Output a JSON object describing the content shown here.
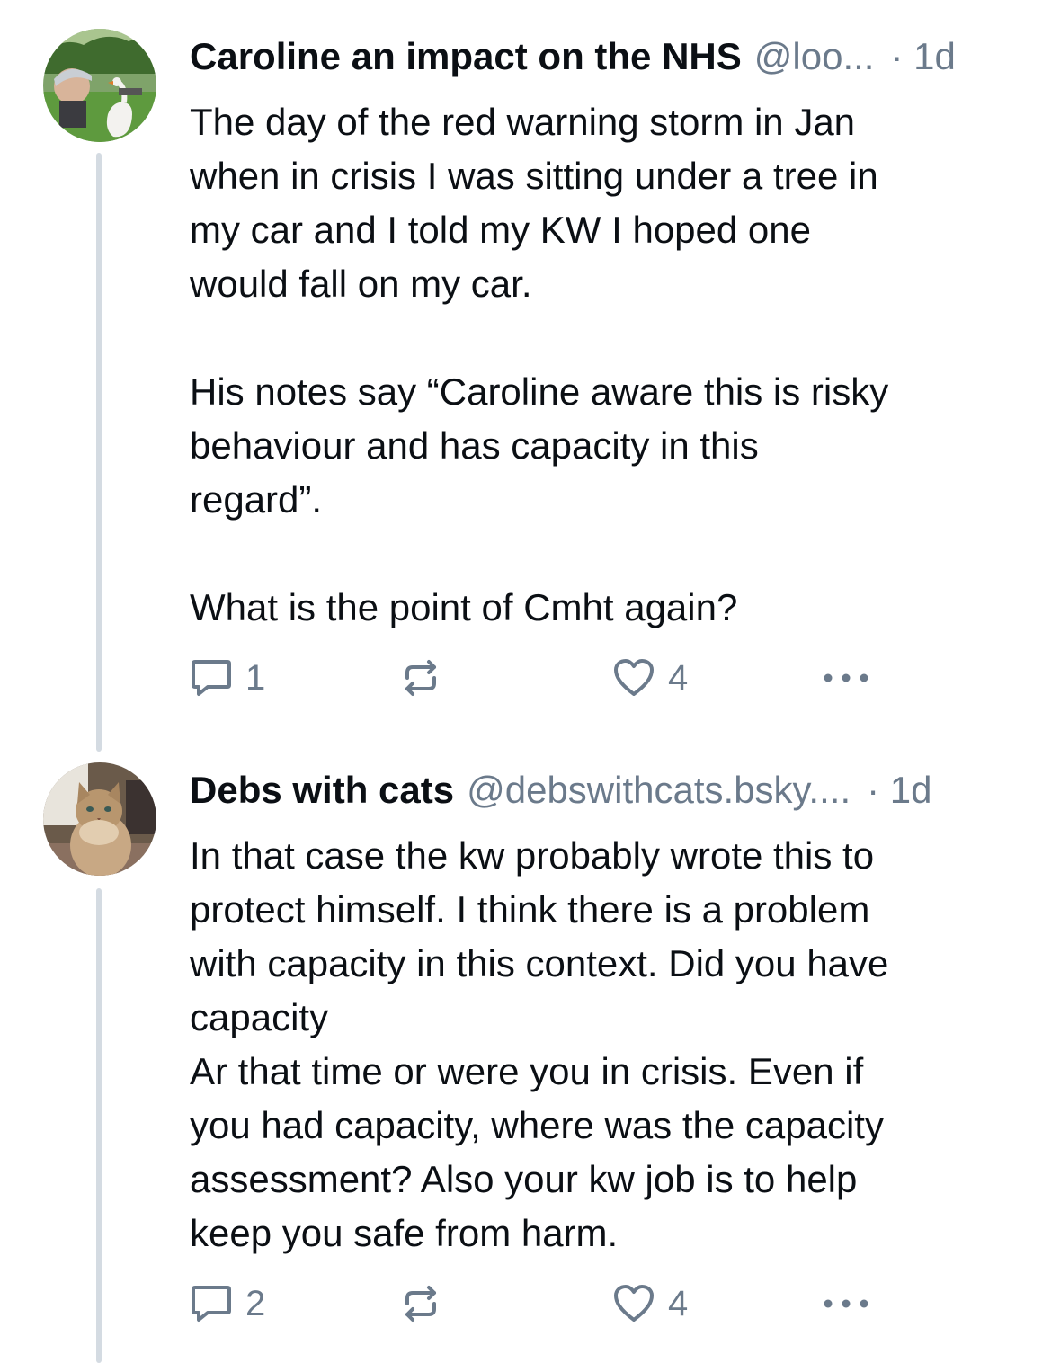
{
  "posts": [
    {
      "author": {
        "display_name": "Caroline an impact on the NHS",
        "handle": "@loo...",
        "avatar_icon": "avatar-photo-person-with-swan"
      },
      "time": "· 1d",
      "text": "The day of the red warning storm in Jan\nwhen in crisis I was sitting under a tree in\nmy car and I told my KW I hoped one\nwould fall on my car.\n\nHis notes say “Caroline aware this is risky\nbehaviour and has capacity in this\nregard”.\n\nWhat is the point of Cmht again?",
      "replies": "1",
      "likes": "4"
    },
    {
      "author": {
        "display_name": "Debs with cats",
        "handle": "@debswithcats.bsky....",
        "avatar_icon": "avatar-photo-cat"
      },
      "time": "· 1d",
      "text": "In that case the kw probably wrote this to\nprotect himself. I think there is a problem\nwith capacity in this context. Did you have\ncapacity\nAr that time or were you in crisis. Even if\nyou had capacity, where was the capacity\nassessment? Also your kw job is to help\nkeep you safe from  harm.",
      "replies": "2",
      "likes": "4"
    }
  ],
  "icons": {
    "reply": "speech-bubble-icon",
    "repost": "repost-arrows-icon",
    "like": "heart-icon",
    "more": "ellipsis-icon"
  },
  "colors": {
    "text": "#0b0f14",
    "muted": "#6b7a8b",
    "thread_line": "#d4dbe2",
    "background": "#ffffff"
  }
}
